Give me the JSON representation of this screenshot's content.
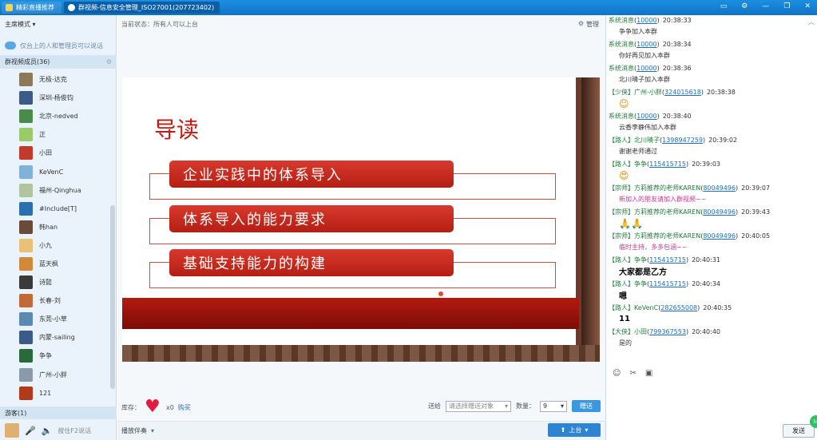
{
  "titlebar": {
    "tab1": "精彩直播推荐",
    "tab2": "群视频-信息安全管理_ISO27001(207723402)"
  },
  "left": {
    "mode": "主席模式",
    "notice": "仅台上的人和管理员可以说话",
    "members_header": "群视频成员(36)",
    "members": [
      {
        "name": "无极-达克",
        "color": "#8a7a5a"
      },
      {
        "name": "深圳-杨俊钧",
        "color": "#3b5c88"
      },
      {
        "name": "北京-nedved",
        "color": "#4a8a4a"
      },
      {
        "name": "正",
        "color": "#9acb6a"
      },
      {
        "name": "小田",
        "color": "#c0392b"
      },
      {
        "name": "KeVenC",
        "color": "#7fb3d8"
      },
      {
        "name": "福州-Qinghua",
        "color": "#b0c4a0"
      },
      {
        "name": "#Include[T]",
        "color": "#2c6fb0"
      },
      {
        "name": "韩han",
        "color": "#6a4a3a"
      },
      {
        "name": "小九",
        "color": "#e8c07a"
      },
      {
        "name": "蓝天枫",
        "color": "#d08a3a"
      },
      {
        "name": "诗懿",
        "color": "#3a3a3a"
      },
      {
        "name": "长春-刘",
        "color": "#c06a3a"
      },
      {
        "name": "东莞-小草",
        "color": "#5a8ab0"
      },
      {
        "name": "内蒙-sailing",
        "color": "#3a5a8a"
      },
      {
        "name": "争争",
        "color": "#2a6a3a"
      },
      {
        "name": "广州-小胖",
        "color": "#8a9aaa"
      },
      {
        "name": "121",
        "color": "#b03a1a"
      }
    ],
    "guests": "游客(1)",
    "bottom_label": "按住F2说话"
  },
  "center": {
    "status": "当前状态：所有人可以上台",
    "manage": "管理",
    "slide": {
      "title": "导读",
      "items": [
        "企业实践中的体系导入",
        "体系导入的能力要求",
        "基础支持能力的构建"
      ]
    },
    "stock_label": "库存：",
    "stock_count": "x0",
    "buy": "购买",
    "gift_label": "送给",
    "gift_target": "请选择赠送对象",
    "qty_label": "数量：",
    "qty": "9",
    "send_gift": "赠送",
    "play_companion": "播放伴奏",
    "on_stage": "上台"
  },
  "chat": {
    "messages": [
      {
        "sender": "系统消息",
        "qq": "10000",
        "time": "20:38:33",
        "text": "争争加入本群"
      },
      {
        "sender": "系统消息",
        "qq": "10000",
        "time": "20:38:34",
        "text": "你好再见加入本群"
      },
      {
        "sender": "系统消息",
        "qq": "10000",
        "time": "20:38:36",
        "text": "北川晴子加入本群"
      },
      {
        "sender": "【少侠】广州-小胖",
        "qq": "324015618",
        "time": "20:38:38",
        "emoji": "☺"
      },
      {
        "sender": "系统消息",
        "qq": "10000",
        "time": "20:38:40",
        "text": "云香李静伟加入本群"
      },
      {
        "sender": "【路人】北川晴子",
        "qq": "1398947259",
        "time": "20:39:02",
        "text": "谢谢老师通过"
      },
      {
        "sender": "【路人】争争",
        "qq": "115415715",
        "time": "20:39:03",
        "emoji": "😍"
      },
      {
        "sender": "【宗师】方莉推荐的老师KAREN",
        "qq": "80049496",
        "time": "20:39:07",
        "text": "新加入的朋友请加入群视频~~",
        "style": "pink"
      },
      {
        "sender": "【宗师】方莉推荐的老师KAREN",
        "qq": "80049496",
        "time": "20:39:43",
        "emoji": "🙏🙏"
      },
      {
        "sender": "【宗师】方莉推荐的老师KAREN",
        "qq": "80049496",
        "time": "20:40:05",
        "text": "临时主持，多多包涵~~",
        "style": "pink"
      },
      {
        "sender": "【路人】争争",
        "qq": "115415715",
        "time": "20:40:31",
        "text": "大家都是乙方",
        "style": "big"
      },
      {
        "sender": "【路人】争争",
        "qq": "115415715",
        "time": "20:40:34",
        "text": "嗯",
        "style": "big"
      },
      {
        "sender": "【路人】KeVenC",
        "qq": "282655008",
        "time": "20:40:35",
        "text": "11",
        "style": "big"
      },
      {
        "sender": "【大侠】小田",
        "qq": "799367553",
        "time": "20:40:40",
        "text": "是的"
      }
    ],
    "send": "发送"
  }
}
